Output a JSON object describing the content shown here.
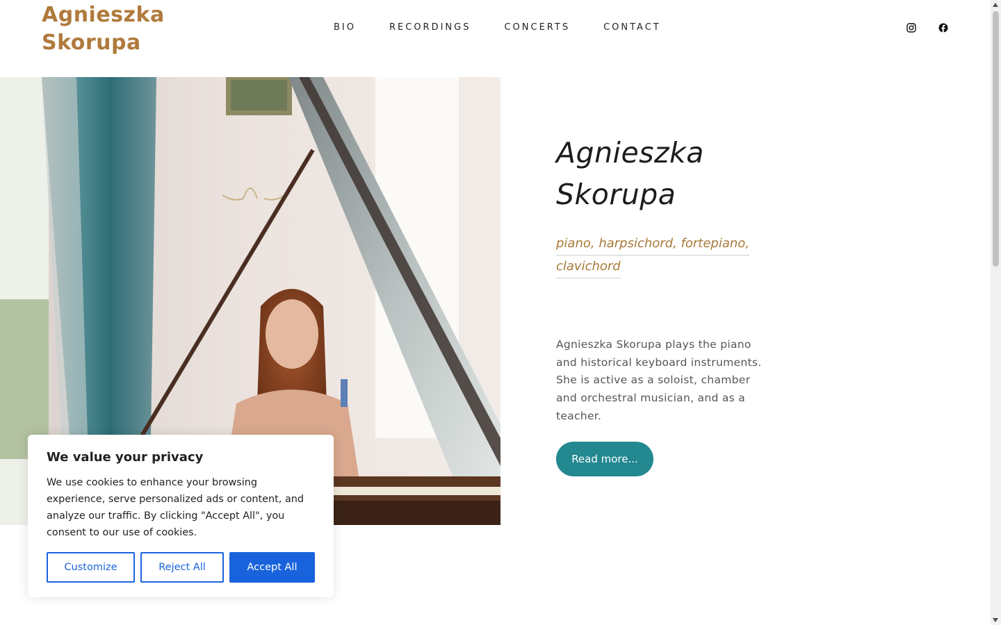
{
  "header": {
    "logo_line1": "Agnieszka",
    "logo_line2": "Skorupa",
    "nav": [
      {
        "label": "BIO"
      },
      {
        "label": "RECORDINGS"
      },
      {
        "label": "CONCERTS"
      },
      {
        "label": "CONTACT"
      }
    ],
    "social": [
      "instagram-icon",
      "facebook-icon"
    ]
  },
  "hero": {
    "title_line1": "Agnieszka",
    "title_line2": "Skorupa",
    "subtitle_line1": "piano, harpsichord, fortepiano,",
    "subtitle_line2": "clavichord",
    "description": "Agnieszka Skorupa plays the piano and historical keyboard instruments. She is active as a soloist, chamber and orchestral musician, and as a teacher.",
    "button_label": "Read more..."
  },
  "cookie": {
    "title": "We value your privacy",
    "text": "We use cookies to enhance your browsing experience, serve personalized ads or content, and analyze our traffic. By clicking \"Accept All\", you consent to our use of cookies.",
    "customize_label": "Customize",
    "reject_label": "Reject All",
    "accept_label": "Accept All"
  },
  "colors": {
    "brand_gold": "#b07a3c",
    "accent_teal": "#238890",
    "cookie_blue": "#1863dc"
  }
}
